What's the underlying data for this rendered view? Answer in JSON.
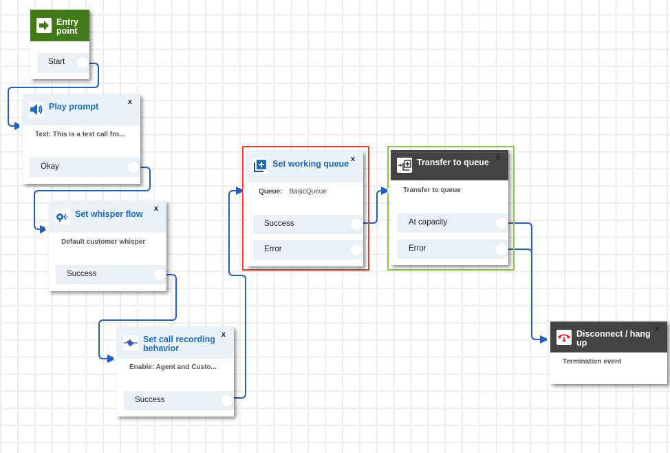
{
  "colors": {
    "connector": "#1f5fc6",
    "title_blue": "#1d6ac2",
    "entry_green": "#427a1a",
    "dark_header": "#444444",
    "selected_red": "#e8432c",
    "selected_green": "#8bc34a"
  },
  "blocks": {
    "entry_point": {
      "title": "Entry point",
      "icon": "arrow-right-icon",
      "outputs": {
        "start": "Start"
      }
    },
    "play_prompt": {
      "title": "Play prompt",
      "icon": "speaker-icon",
      "close": "x",
      "description": "Text: This is a test call fro...",
      "outputs": {
        "okay": "Okay"
      }
    },
    "set_whisper_flow": {
      "title": "Set whisper flow",
      "icon": "whisper-icon",
      "close": "x",
      "description": "Default customer whisper",
      "outputs": {
        "success": "Success"
      }
    },
    "set_call_recording_behavior": {
      "title": "Set call recording behavior",
      "icon": "waveform-icon",
      "close": "x",
      "description": "Enable: Agent and Custo...",
      "outputs": {
        "success": "Success"
      }
    },
    "set_working_queue": {
      "title": "Set working queue",
      "icon": "queue-add-icon",
      "close": "x",
      "queue_label": "Queue:",
      "queue_value": "BasicQueue",
      "outputs": {
        "success": "Success",
        "error": "Error"
      },
      "selected": true,
      "selection_color": "red"
    },
    "transfer_to_queue": {
      "title": "Transfer to queue",
      "icon": "transfer-queue-icon",
      "close": "x",
      "description": "Transfer to queue",
      "outputs": {
        "at_capacity": "At capacity",
        "error": "Error"
      },
      "selected": true,
      "selection_color": "green"
    },
    "disconnect_hang_up": {
      "title": "Disconnect / hang up",
      "icon": "hang-up-icon",
      "close": "x",
      "description": "Termination event"
    }
  },
  "connections": [
    {
      "from": "entry_point.start",
      "to": "play_prompt"
    },
    {
      "from": "play_prompt.okay",
      "to": "set_whisper_flow"
    },
    {
      "from": "set_whisper_flow.success",
      "to": "set_call_recording_behavior"
    },
    {
      "from": "set_call_recording_behavior.success",
      "to": "set_working_queue"
    },
    {
      "from": "set_working_queue.success",
      "to": "transfer_to_queue"
    },
    {
      "from": "transfer_to_queue.at_capacity",
      "to": "disconnect_hang_up"
    },
    {
      "from": "transfer_to_queue.error",
      "to": "disconnect_hang_up"
    }
  ]
}
